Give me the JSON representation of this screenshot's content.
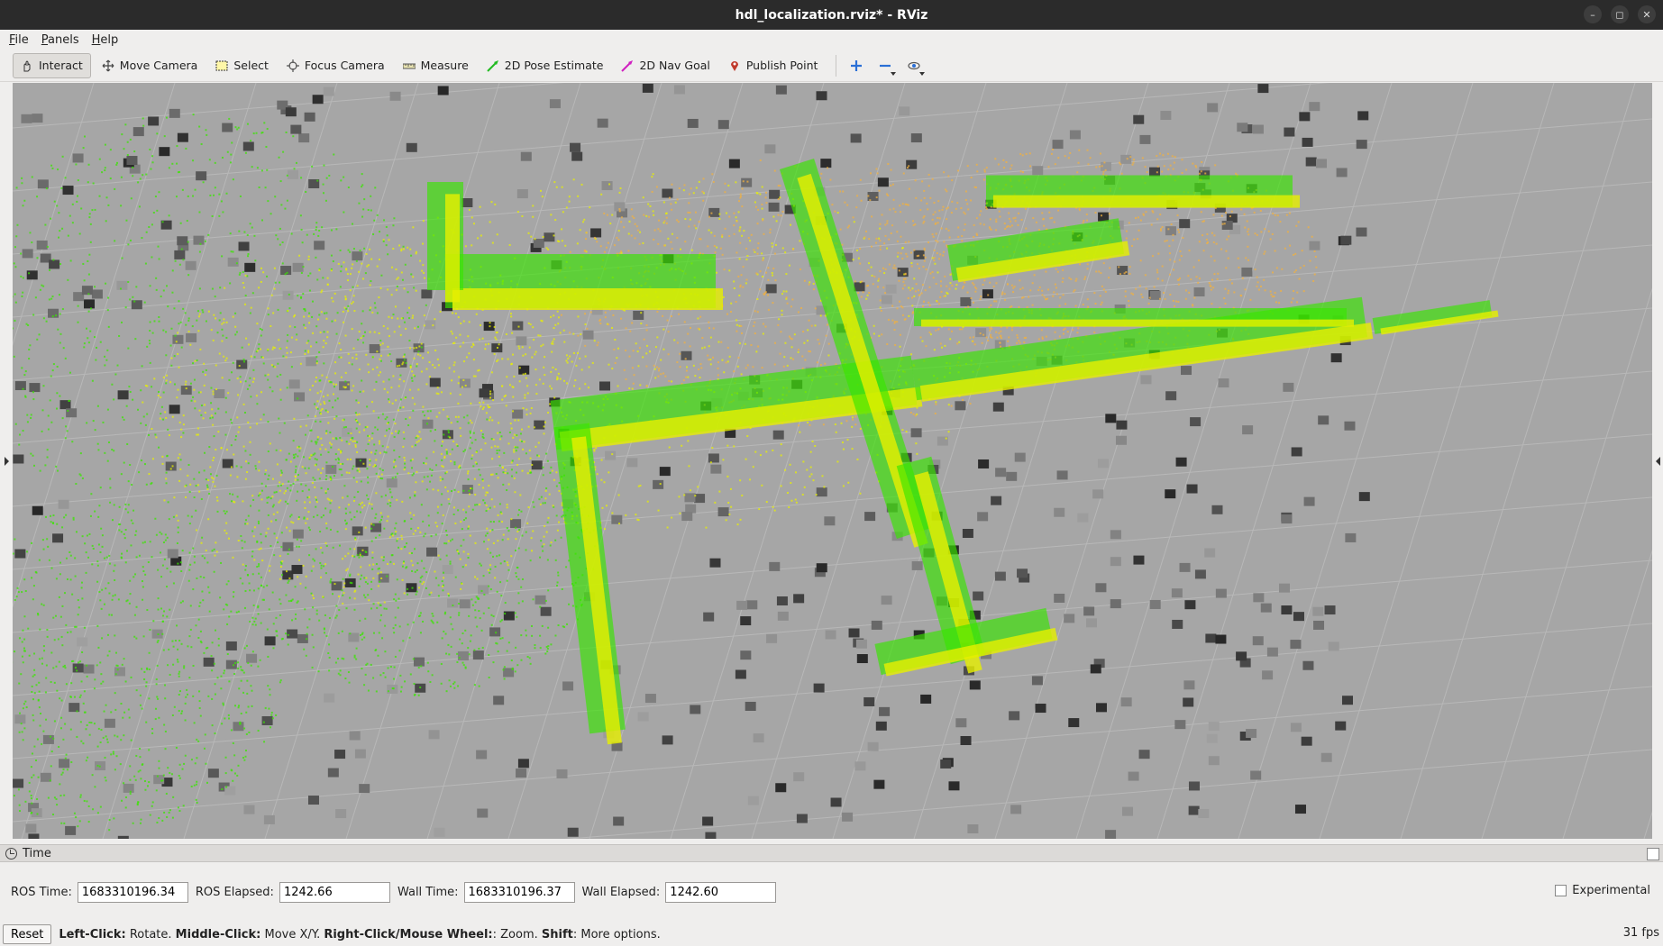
{
  "window": {
    "title": "hdl_localization.rviz* - RViz"
  },
  "menu": {
    "items": [
      "File",
      "Panels",
      "Help"
    ]
  },
  "toolbar": {
    "tools": [
      {
        "label": "Interact",
        "icon": "hand-icon",
        "active": true
      },
      {
        "label": "Move Camera",
        "icon": "move-camera-icon"
      },
      {
        "label": "Select",
        "icon": "select-box-icon"
      },
      {
        "label": "Focus Camera",
        "icon": "focus-camera-icon"
      },
      {
        "label": "Measure",
        "icon": "ruler-icon"
      },
      {
        "label": "2D Pose Estimate",
        "icon": "green-arrow-icon"
      },
      {
        "label": "2D Nav Goal",
        "icon": "pink-arrow-icon"
      },
      {
        "label": "Publish Point",
        "icon": "map-pin-icon"
      }
    ]
  },
  "time_panel": {
    "title": "Time",
    "ros_time_label": "ROS Time:",
    "ros_time": "1683310196.34",
    "ros_elapsed_label": "ROS Elapsed:",
    "ros_elapsed": "1242.66",
    "wall_time_label": "Wall Time:",
    "wall_time": "1683310196.37",
    "wall_elapsed_label": "Wall Elapsed:",
    "wall_elapsed": "1242.60",
    "experimental_label": "Experimental"
  },
  "status": {
    "reset_label": "Reset",
    "hint_parts": [
      {
        "bold": "Left-Click:",
        "text": " Rotate. "
      },
      {
        "bold": "Middle-Click:",
        "text": " Move X/Y. "
      },
      {
        "bold": "Right-Click/Mouse Wheel:",
        "text": ": Zoom. "
      },
      {
        "bold": "Shift",
        "text": ": More options."
      }
    ],
    "fps": "31 fps"
  },
  "colors": {
    "ground": "#a3a3a3",
    "grid": "#b8b8b8",
    "points_green": "#39e600",
    "points_yellow": "#e8f000",
    "points_orange": "#f0b040"
  }
}
